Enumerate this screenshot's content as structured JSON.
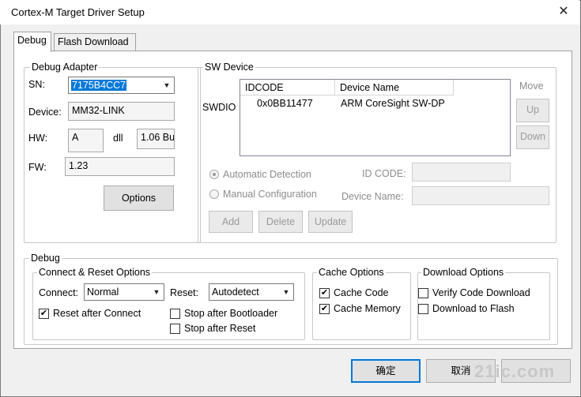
{
  "window": {
    "title": "Cortex-M Target Driver Setup",
    "close_glyph": "✕"
  },
  "tabs": [
    {
      "label": "Debug"
    },
    {
      "label": "Flash Download"
    }
  ],
  "debug_adapter": {
    "title": "Debug Adapter",
    "sn_label": "SN:",
    "sn_value": "7175B4CC7",
    "device_label": "Device:",
    "device_value": "MM32-LINK",
    "hw_label": "HW:",
    "hw_value": "A",
    "dll_label": "dll",
    "dll_value": "1.06 Bu",
    "fw_label": "FW:",
    "fw_value": "1.23",
    "options_button": "Options"
  },
  "sw_device": {
    "title": "SW Device",
    "swdio_label": "SWDIO",
    "columns": [
      "IDCODE",
      "Device Name"
    ],
    "rows": [
      {
        "idcode": "0x0BB11477",
        "name": "ARM CoreSight SW-DP"
      }
    ],
    "move_label": "Move",
    "up_button": "Up",
    "down_button": "Down",
    "auto_detection": "Automatic Detection",
    "manual_config": "Manual Configuration",
    "id_code_label": "ID CODE:",
    "device_name_label": "Device Name:",
    "add_button": "Add",
    "delete_button": "Delete",
    "update_button": "Update"
  },
  "debug": {
    "title": "Debug",
    "connect_reset": {
      "title": "Connect & Reset Options",
      "connect_label": "Connect:",
      "connect_value": "Normal",
      "reset_label": "Reset:",
      "reset_value": "Autodetect",
      "reset_after_connect": "Reset after Connect",
      "stop_after_bootloader": "Stop after Bootloader",
      "stop_after_reset": "Stop after Reset"
    },
    "cache": {
      "title": "Cache Options",
      "cache_code": "Cache Code",
      "cache_memory": "Cache Memory"
    },
    "download": {
      "title": "Download Options",
      "verify": "Verify Code Download",
      "download_to_flash": "Download to Flash"
    }
  },
  "checks": {
    "on": "✔"
  },
  "footer": {
    "ok_button": "确定",
    "cancel_button": "取消"
  },
  "watermark": "21ic.com"
}
